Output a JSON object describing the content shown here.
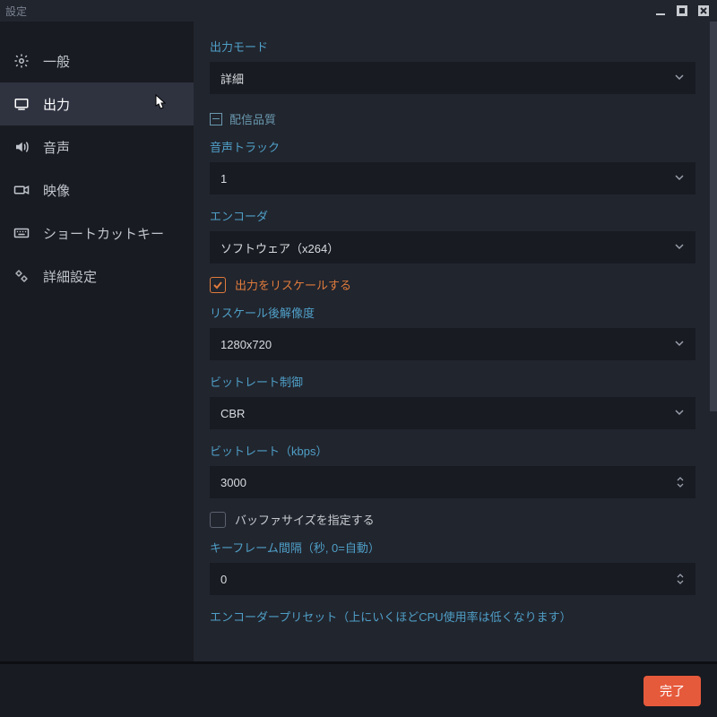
{
  "window": {
    "title": "設定"
  },
  "sidebar": {
    "items": [
      {
        "label": "一般",
        "icon": "gear"
      },
      {
        "label": "出力",
        "icon": "monitor",
        "active": true
      },
      {
        "label": "音声",
        "icon": "speaker"
      },
      {
        "label": "映像",
        "icon": "camera"
      },
      {
        "label": "ショートカットキー",
        "icon": "keyboard"
      },
      {
        "label": "詳細設定",
        "icon": "gears"
      }
    ]
  },
  "form": {
    "output_mode": {
      "label": "出力モード",
      "value": "詳細"
    },
    "section_quality": "配信品質",
    "audio_track": {
      "label": "音声トラック",
      "value": "1"
    },
    "encoder": {
      "label": "エンコーダ",
      "value": "ソフトウェア（x264）"
    },
    "rescale": {
      "label": "出力をリスケールする",
      "checked": true
    },
    "rescale_res": {
      "label": "リスケール後解像度",
      "value": "1280x720"
    },
    "rate_control": {
      "label": "ビットレート制御",
      "value": "CBR"
    },
    "bitrate": {
      "label": "ビットレート（kbps）",
      "value": "3000"
    },
    "buffer_size": {
      "label": "バッファサイズを指定する",
      "checked": false
    },
    "keyframe": {
      "label": "キーフレーム間隔（秒, 0=自動）",
      "value": "0"
    },
    "preset": {
      "label": "エンコーダープリセット（上にいくほどCPU使用率は低くなります）"
    }
  },
  "footer": {
    "done": "完了"
  }
}
